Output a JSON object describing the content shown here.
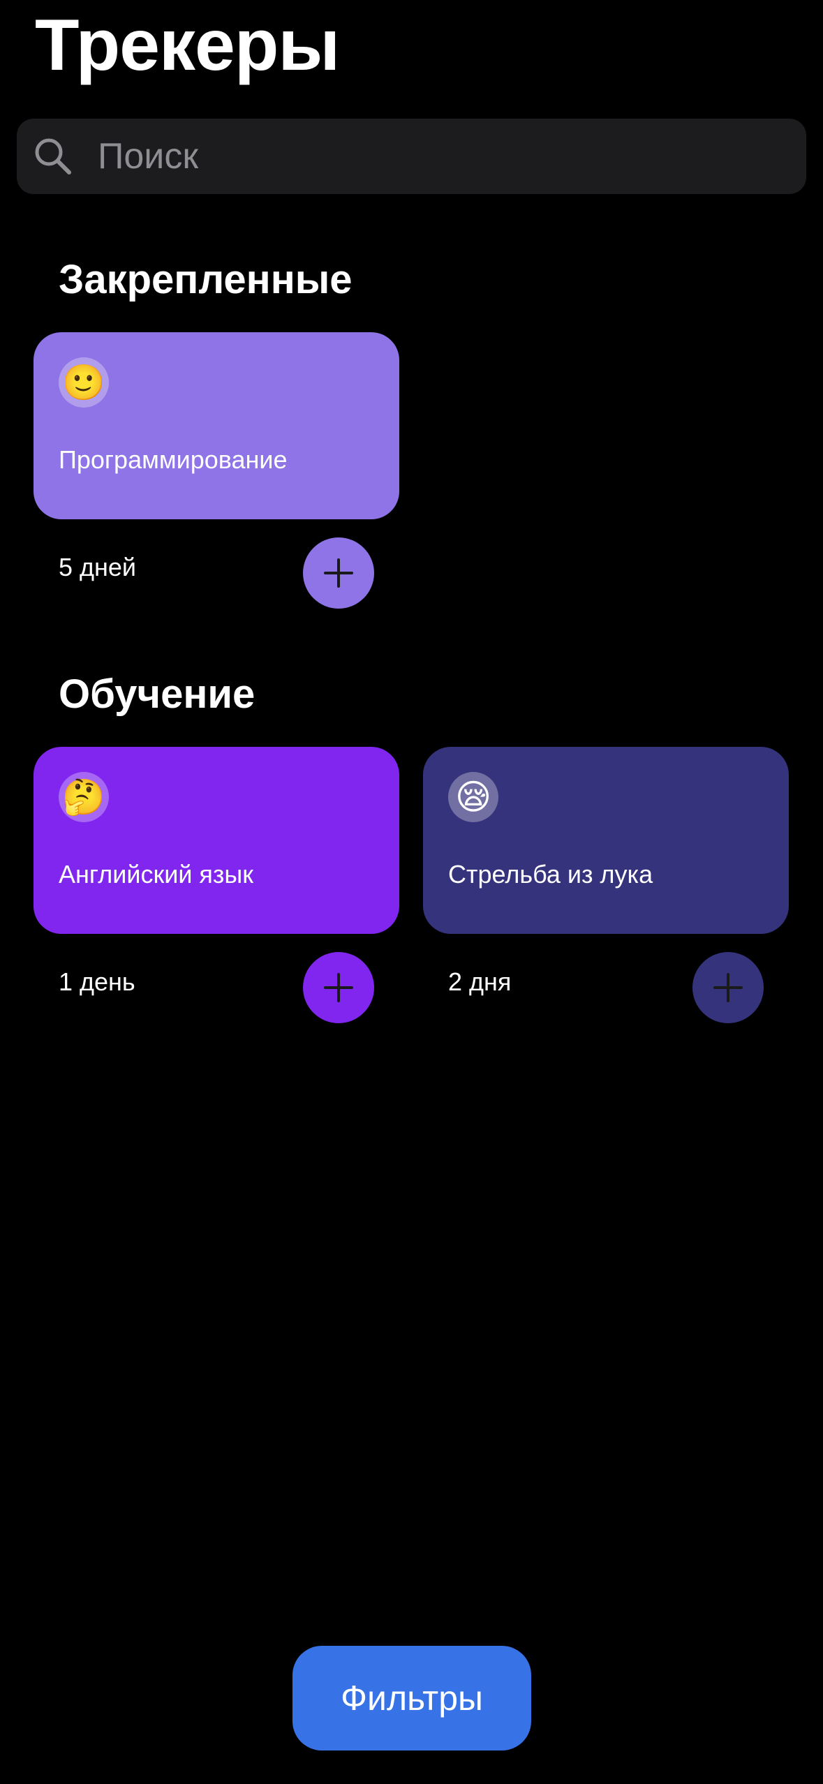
{
  "header": {
    "title": "Трекеры"
  },
  "search": {
    "icon": "search-icon",
    "placeholder": "Поиск",
    "value": ""
  },
  "sections": [
    {
      "title": "Закрепленные",
      "trackers": [
        {
          "emoji": "🙂",
          "name": "Программирование",
          "count": "5 дней",
          "color": "#8e74e6"
        }
      ]
    },
    {
      "title": "Обучение",
      "trackers": [
        {
          "emoji": "🤔",
          "name": "Английский язык",
          "count": "1 день",
          "color": "#8026ef"
        },
        {
          "emoji": "😪",
          "name": "Стрельба из лука",
          "count": "2 дня",
          "color": "#35337b"
        }
      ]
    }
  ],
  "footer": {
    "filters_label": "Фильтры",
    "filters_color": "#3772e7"
  },
  "icons": {
    "add": "plus-icon"
  }
}
